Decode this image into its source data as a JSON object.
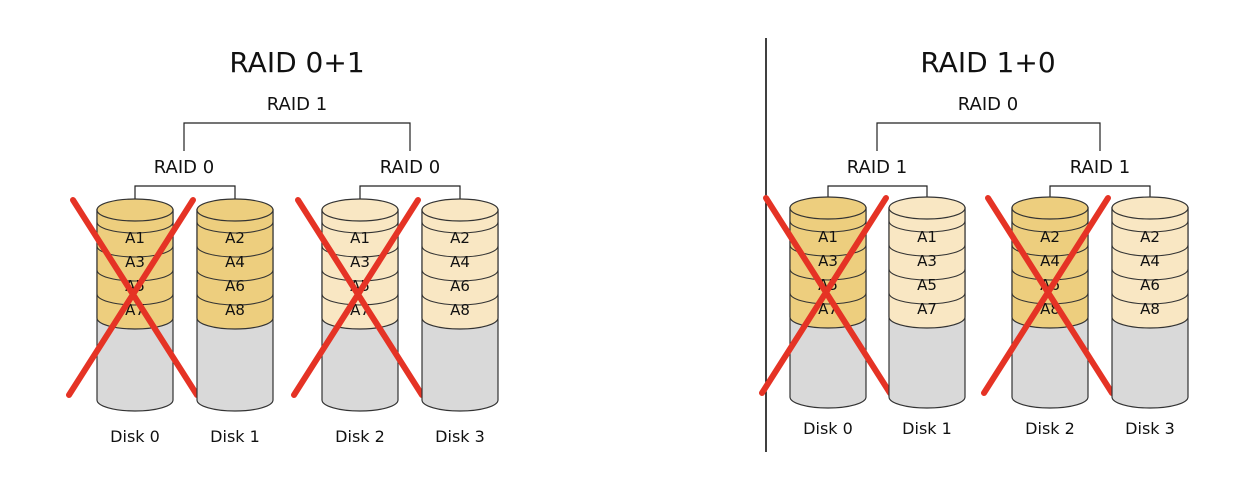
{
  "colors": {
    "dark_stripe": "#EDCE7E",
    "light_stripe": "#F9E7C3",
    "empty": "#D9D9D9",
    "outline": "#333333",
    "cross": "#E53325"
  },
  "panels": [
    {
      "title": "RAID 0+1",
      "top_label": "RAID 1",
      "groups": [
        {
          "label": "RAID 0",
          "disks": [
            {
              "name": "Disk 0",
              "tone": "dark",
              "blocks": [
                "A1",
                "A3",
                "A5",
                "A7"
              ],
              "failed": true
            },
            {
              "name": "Disk 1",
              "tone": "dark",
              "blocks": [
                "A2",
                "A4",
                "A6",
                "A8"
              ],
              "failed": false
            }
          ]
        },
        {
          "label": "RAID 0",
          "disks": [
            {
              "name": "Disk 2",
              "tone": "light",
              "blocks": [
                "A1",
                "A3",
                "A5",
                "A7"
              ],
              "failed": true
            },
            {
              "name": "Disk 3",
              "tone": "light",
              "blocks": [
                "A2",
                "A4",
                "A6",
                "A8"
              ],
              "failed": false
            }
          ]
        }
      ]
    },
    {
      "title": "RAID 1+0",
      "top_label": "RAID 0",
      "groups": [
        {
          "label": "RAID 1",
          "disks": [
            {
              "name": "Disk 0",
              "tone": "dark",
              "blocks": [
                "A1",
                "A3",
                "A5",
                "A7"
              ],
              "failed": true
            },
            {
              "name": "Disk 1",
              "tone": "light",
              "blocks": [
                "A1",
                "A3",
                "A5",
                "A7"
              ],
              "failed": false
            }
          ]
        },
        {
          "label": "RAID 1",
          "disks": [
            {
              "name": "Disk 2",
              "tone": "dark",
              "blocks": [
                "A2",
                "A4",
                "A6",
                "A8"
              ],
              "failed": true
            },
            {
              "name": "Disk 3",
              "tone": "light",
              "blocks": [
                "A2",
                "A4",
                "A6",
                "A8"
              ],
              "failed": false
            }
          ]
        }
      ]
    }
  ]
}
